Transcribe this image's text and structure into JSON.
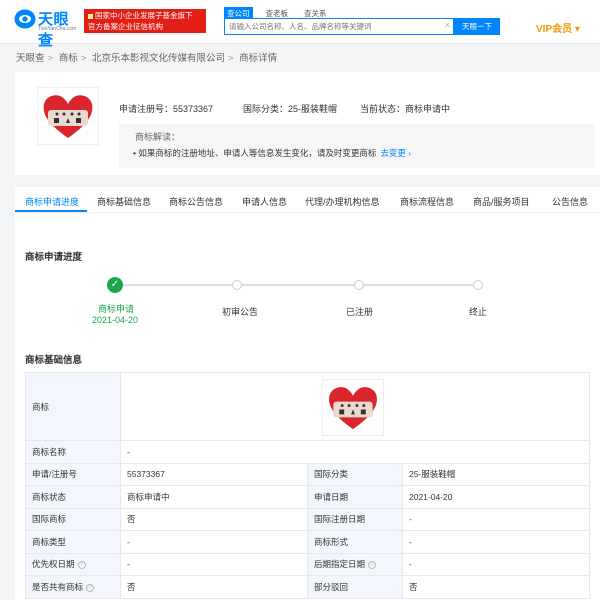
{
  "header": {
    "logo_text": "天眼查",
    "logo_sub": "TianYanCha.com",
    "promo_line1": "国家中小企业发展子基金旗下",
    "promo_line2": "官方备案企业征信机构",
    "search_tabs": [
      "查公司",
      "查老板",
      "查关系"
    ],
    "search_placeholder": "请输入公司名称、人名、品牌名称等关键词",
    "search_button": "天眼一下",
    "vip_label": "VIP会员 ▾"
  },
  "breadcrumb": [
    "天眼查",
    "商标",
    "北京乐本影视文化传媒有限公司",
    "商标详情"
  ],
  "summary": {
    "reg_no": "申请注册号：55373367",
    "class": "国际分类：25-服装鞋帽",
    "status": "当前状态：商标申请中",
    "interp_title": "商标解读：",
    "interp_text": "• 如果商标的注册地址、申请人等信息发生变化，请及时变更商标",
    "interp_link": "去变更 ›"
  },
  "tabs": [
    "商标申请进度",
    "商标基础信息",
    "商标公告信息",
    "申请人信息",
    "代理/办理机构信息",
    "商标流程信息",
    "商品/服务项目",
    "公告信息"
  ],
  "progress": {
    "title": "商标申请进度",
    "steps": [
      {
        "label": "商标申请",
        "date": "2021-04-20",
        "done": true
      },
      {
        "label": "初审公告",
        "date": "",
        "done": false
      },
      {
        "label": "已注册",
        "date": "",
        "done": false
      },
      {
        "label": "终止",
        "date": "",
        "done": false
      }
    ]
  },
  "basic": {
    "title": "商标基础信息",
    "rows": {
      "r1k": "商标",
      "r2k": "商标名称",
      "r2v": "-",
      "r3k": "申请/注册号",
      "r3v": "55373367",
      "r3k2": "国际分类",
      "r3v2": "25-服装鞋帽",
      "r4k": "商标状态",
      "r4v": "商标申请中",
      "r4k2": "申请日期",
      "r4v2": "2021-04-20",
      "r5k": "国际商标",
      "r5v": "否",
      "r5k2": "国际注册日期",
      "r5v2": "-",
      "r6k": "商标类型",
      "r6v": "-",
      "r6k2": "商标形式",
      "r6v2": "-",
      "r7k": "优先权日期",
      "r7v": "-",
      "r7k2": "后期指定日期",
      "r7v2": "-",
      "r8k": "是否共有商标",
      "r8v": "否",
      "r8k2": "部分驳回",
      "r8v2": "否"
    }
  },
  "colors": {
    "brand_blue": "#0084ff",
    "promo_red": "#e21e16",
    "vip_orange": "#f39800",
    "success_green": "#19a74d",
    "heart_red": "#d9262c"
  }
}
